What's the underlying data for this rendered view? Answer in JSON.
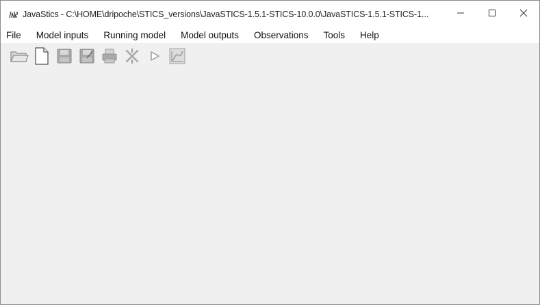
{
  "window": {
    "title": "JavaStics - C:\\HOME\\dripoche\\STICS_versions\\JavaSTICS-1.5.1-STICS-10.0.0\\JavaSTICS-1.5.1-STICS-1...",
    "app_icon": "stics-logo-icon",
    "controls": {
      "minimize": "minimize-icon",
      "maximize": "maximize-icon",
      "close": "close-icon"
    }
  },
  "menubar": {
    "items": [
      {
        "label": "File"
      },
      {
        "label": "Model inputs"
      },
      {
        "label": "Running model"
      },
      {
        "label": "Model outputs"
      },
      {
        "label": "Observations"
      },
      {
        "label": "Tools"
      },
      {
        "label": "Help"
      }
    ]
  },
  "toolbar": {
    "buttons": [
      {
        "icon": "open-folder-icon"
      },
      {
        "icon": "new-file-icon"
      },
      {
        "icon": "save-icon"
      },
      {
        "icon": "save-as-icon"
      },
      {
        "icon": "print-icon"
      },
      {
        "icon": "tools-icon"
      },
      {
        "icon": "run-icon"
      },
      {
        "icon": "chart-icon"
      }
    ]
  },
  "colors": {
    "window_bg": "#f0f0f0",
    "titlebar_bg": "#ffffff",
    "icon_gray": "#9a9a9a"
  }
}
